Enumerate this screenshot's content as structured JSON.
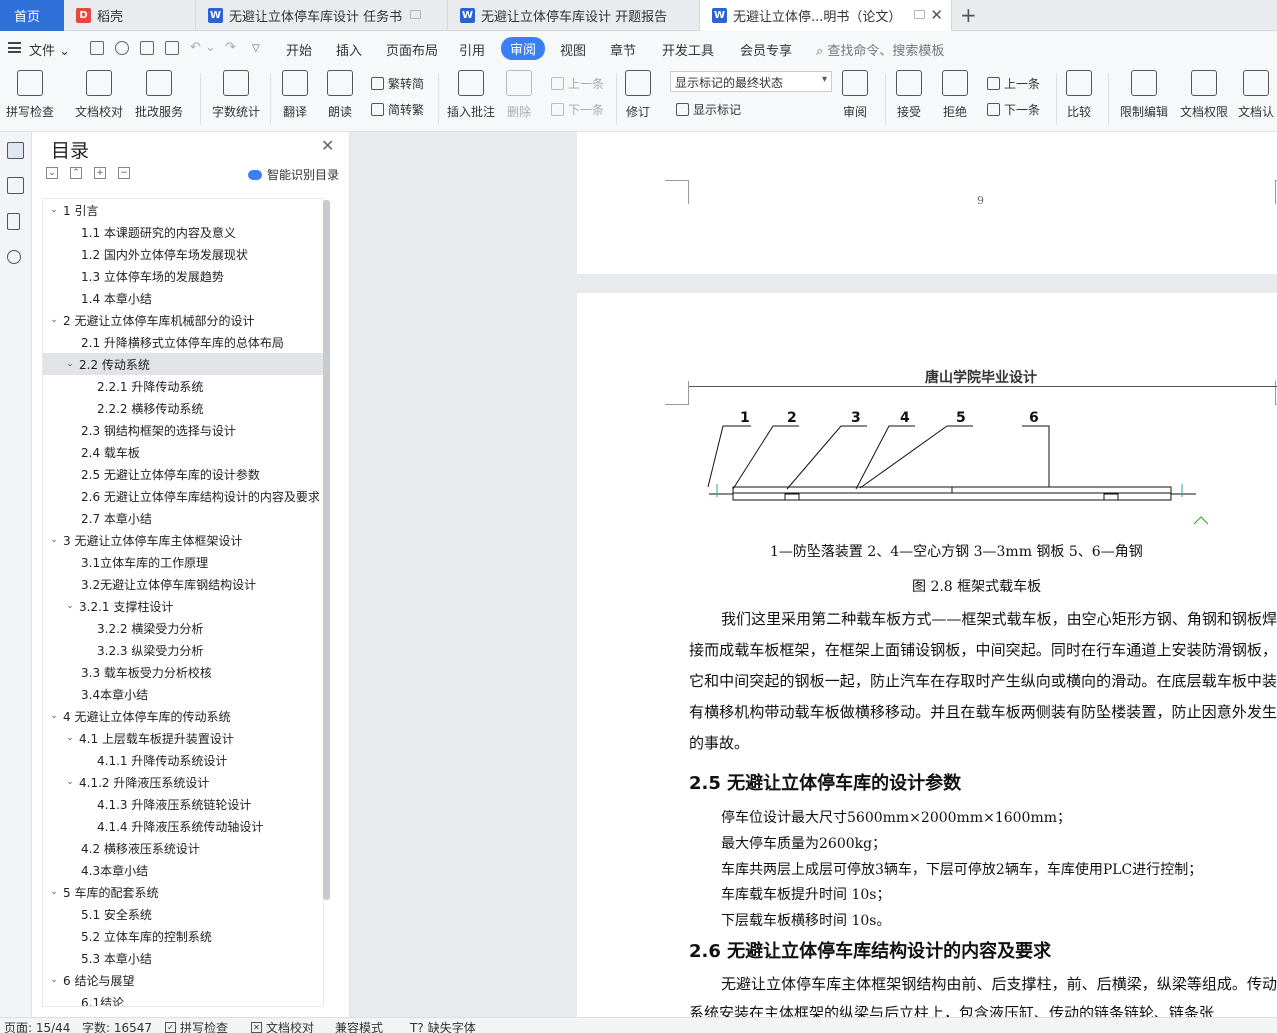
{
  "tabs": {
    "home": "首页",
    "items": [
      {
        "label": "稻壳",
        "icon": "daoke-icon"
      },
      {
        "label": "无避让立体停车库设计 任务书",
        "icon": "wps-writer-icon"
      },
      {
        "label": "无避让立体停车库设计 开题报告",
        "icon": "wps-writer-icon"
      },
      {
        "label": "无避让立体停...明书（论文）",
        "icon": "wps-writer-icon"
      }
    ],
    "add": "+"
  },
  "menu": {
    "file": "文件",
    "items": [
      "开始",
      "插入",
      "页面布局",
      "引用",
      "审阅",
      "视图",
      "章节",
      "开发工具",
      "会员专享"
    ],
    "active": "审阅",
    "search": "查找命令、搜索模板"
  },
  "ribbon": {
    "spell_check": "拼写检查",
    "doc_proof": "文档校对",
    "review_service": "批改服务",
    "word_count": "字数统计",
    "translate": "翻译",
    "read_aloud": "朗读",
    "trad_simp": "繁转简",
    "simp_trad": "简转繁",
    "insert_comment": "插入批注",
    "delete": "删除",
    "prev_comment": "上一条",
    "next_comment": "下一条",
    "track_changes": "修订",
    "markup_mode": "显示标记的最终状态",
    "show_markup": "显示标记",
    "review": "审阅",
    "accept": "接受",
    "reject": "拒绝",
    "prev_change": "上一条",
    "next_change": "下一条",
    "compare": "比较",
    "restrict_edit": "限制编辑",
    "doc_permission": "文档权限",
    "doc_cert": "文档认"
  },
  "toc": {
    "title": "目录",
    "smart_label": "智能识别目录",
    "items": [
      {
        "label": "1  引言",
        "level": 1,
        "expanded": true
      },
      {
        "label": "1.1  本课题研究的内容及意义",
        "level": 2
      },
      {
        "label": "1.2  国内外立体停车场发展现状",
        "level": 2
      },
      {
        "label": "1.3  立体停车场的发展趋势",
        "level": 2
      },
      {
        "label": "1.4  本章小结",
        "level": 2
      },
      {
        "label": "2  无避让立体停车库机械部分的设计",
        "level": 1,
        "expanded": true
      },
      {
        "label": "2.1  升降横移式立体停车库的总体布局",
        "level": 2
      },
      {
        "label": "2.2  传动系统",
        "level": 2,
        "expanded": true,
        "selected": true
      },
      {
        "label": "2.2.1  升降传动系统",
        "level": 3
      },
      {
        "label": "2.2.2  横移传动系统",
        "level": 3
      },
      {
        "label": "2.3  钢结构框架的选择与设计",
        "level": 2
      },
      {
        "label": "2.4  载车板",
        "level": 2
      },
      {
        "label": "2.5  无避让立体停车库的设计参数",
        "level": 2
      },
      {
        "label": "2.6  无避让立体停车库结构设计的内容及要求",
        "level": 2
      },
      {
        "label": "2.7  本章小结",
        "level": 2
      },
      {
        "label": "3  无避让立体停车库主体框架设计",
        "level": 1,
        "expanded": true
      },
      {
        "label": "3.1立体车库的工作原理",
        "level": 2
      },
      {
        "label": "3.2无避让立体停车库钢结构设计",
        "level": 2
      },
      {
        "label": "3.2.1  支撑柱设计",
        "level": 2,
        "expanded": true
      },
      {
        "label": "3.2.2  横梁受力分析",
        "level": 3
      },
      {
        "label": "3.2.3  纵梁受力分析",
        "level": 3
      },
      {
        "label": "3.3  载车板受力分析校核",
        "level": 2
      },
      {
        "label": "3.4本章小结",
        "level": 2
      },
      {
        "label": "4  无避让立体停车库的传动系统",
        "level": 1,
        "expanded": true
      },
      {
        "label": "4.1  上层载车板提升装置设计",
        "level": 2,
        "expanded": true
      },
      {
        "label": "4.1.1  升降传动系统设计",
        "level": 3
      },
      {
        "label": "4.1.2  升降液压系统设计",
        "level": 2,
        "expanded": true
      },
      {
        "label": "4.1.3  升降液压系统链轮设计",
        "level": 3
      },
      {
        "label": "4.1.4  升降液压系统传动轴设计",
        "level": 3
      },
      {
        "label": "4.2  横移液压系统设计",
        "level": 2
      },
      {
        "label": "4.3本章小结",
        "level": 2
      },
      {
        "label": "5  车库的配套系统",
        "level": 1,
        "expanded": true
      },
      {
        "label": "5.1  安全系统",
        "level": 2
      },
      {
        "label": "5.2  立体车库的控制系统",
        "level": 2
      },
      {
        "label": "5.3  本章小结",
        "level": 2
      },
      {
        "label": "6  结论与展望",
        "level": 1,
        "expanded": true
      },
      {
        "label": "6.1结论",
        "level": 2
      }
    ]
  },
  "document": {
    "page_number": "9",
    "header": "唐山学院毕业设计",
    "figure_labels": [
      "1",
      "2",
      "3",
      "4",
      "5",
      "6"
    ],
    "figure_legend": "1—防坠落装置    2、4—空心方钢    3—3mm 钢板    5、6—角钢",
    "figure_title": "图 2.8    框架式载车板",
    "paragraph1": "我们这里采用第二种载车板方式——框架式载车板，由空心矩形方钢、角钢和钢板焊接而成载车板框架，在框架上面铺设钢板，中间突起。同时在行车通道上安装防滑钢板，它和中间突起的钢板一起，防止汽车在存取时产生纵向或横向的滑动。在底层载车板中装有横移机构带动载车板做横移移动。并且在载车板两侧装有防坠楼装置，防止因意外发生的事故。",
    "heading_25": "2.5  无避让立体停车库的设计参数",
    "params": [
      "停车位设计最大尺寸5600mm×2000mm×1600mm；",
      "最大停车质量为2600kg；",
      "车库共两层上成层可停放3辆车，下层可停放2辆车，车库使用PLC进行控制；",
      "车库载车板提升时间  10s；",
      "下层载车板横移时间  10s。"
    ],
    "heading_26": "2.6  无避让立体停车库结构设计的内容及要求",
    "paragraph2": "无避让立体停车库主体框架钢结构由前、后支撑柱，前、后横梁，纵梁等组成。传动系统安装在主体框架的纵梁与后立柱上，包含液压缸、传动的链条链轮、链条张"
  },
  "status": {
    "page": "页面: 15/44",
    "words": "字数: 16547",
    "spell_check": "拼写检查",
    "doc_proof": "文档校对",
    "compat": "兼容模式",
    "missing_font": "缺失字体"
  }
}
